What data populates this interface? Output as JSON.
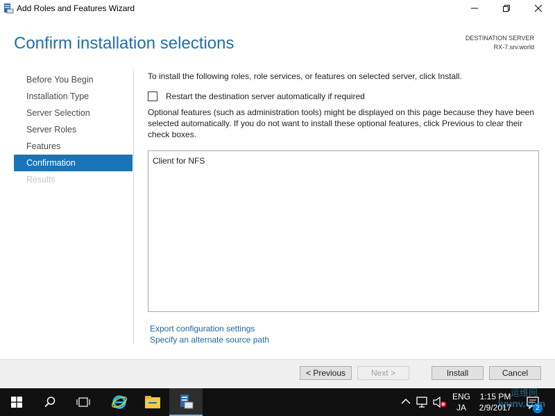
{
  "window": {
    "title": "Add Roles and Features Wizard",
    "icon": "server-manager-icon"
  },
  "header": {
    "title": "Confirm installation selections",
    "destination_label": "DESTINATION SERVER",
    "destination_server": "RX-7.srv.world"
  },
  "nav": {
    "items": [
      {
        "label": "Before You Begin",
        "state": "normal"
      },
      {
        "label": "Installation Type",
        "state": "normal"
      },
      {
        "label": "Server Selection",
        "state": "normal"
      },
      {
        "label": "Server Roles",
        "state": "normal"
      },
      {
        "label": "Features",
        "state": "normal"
      },
      {
        "label": "Confirmation",
        "state": "active"
      },
      {
        "label": "Results",
        "state": "disabled"
      }
    ]
  },
  "main": {
    "intro": "To install the following roles, role services, or features on selected server, click Install.",
    "restart_checkbox_label": "Restart the destination server automatically if required",
    "restart_checked": false,
    "optional_text": "Optional features (such as administration tools) might be displayed on this page because they have been selected automatically. If you do not want to install these optional features, click Previous to clear their check boxes.",
    "selections": [
      "Client for NFS"
    ],
    "export_link": "Export configuration settings",
    "source_path_link": "Specify an alternate source path"
  },
  "footer": {
    "previous_label": "< Previous",
    "next_label": "Next >",
    "install_label": "Install",
    "cancel_label": "Cancel"
  },
  "taskbar": {
    "lang_top": "ENG",
    "lang_bottom": "JA",
    "time": "1:15 PM",
    "date": "2/9/2017",
    "notification_count": "2",
    "watermark_top": "运维网",
    "watermark_bottom": "iyunv.com"
  },
  "colors": {
    "accent": "#1a74b8",
    "title_blue": "#1f6fa8",
    "link_blue": "#1a66a3",
    "taskbar": "#101010"
  }
}
